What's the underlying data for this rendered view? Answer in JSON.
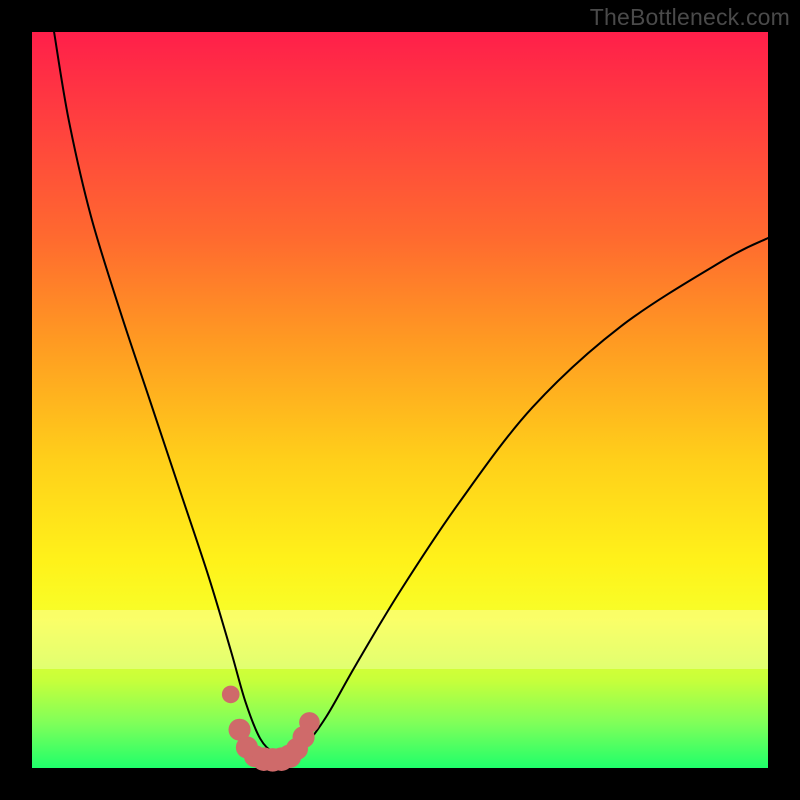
{
  "watermark": "TheBottleneck.com",
  "chart_data": {
    "type": "line",
    "title": "",
    "xlabel": "",
    "ylabel": "",
    "xlim": [
      0,
      100
    ],
    "ylim": [
      0,
      100
    ],
    "series": [
      {
        "name": "bottleneck-curve",
        "x": [
          3,
          5,
          8,
          12,
          16,
          20,
          24,
          27,
          29,
          31,
          33,
          35,
          37,
          40,
          44,
          50,
          58,
          68,
          80,
          94,
          100
        ],
        "values": [
          100,
          88,
          75,
          62,
          50,
          38,
          26,
          16,
          9,
          4,
          2,
          2,
          3,
          7,
          14,
          24,
          36,
          49,
          60,
          69,
          72
        ]
      }
    ],
    "markers": {
      "name": "highlight-dots",
      "color": "#cf6a6a",
      "points": [
        {
          "x": 27.0,
          "y": 10.0,
          "r": 1.2
        },
        {
          "x": 28.2,
          "y": 5.2,
          "r": 1.5
        },
        {
          "x": 29.2,
          "y": 2.8,
          "r": 1.5
        },
        {
          "x": 30.3,
          "y": 1.6,
          "r": 1.5
        },
        {
          "x": 31.5,
          "y": 1.2,
          "r": 1.6
        },
        {
          "x": 32.7,
          "y": 1.1,
          "r": 1.6
        },
        {
          "x": 33.9,
          "y": 1.2,
          "r": 1.6
        },
        {
          "x": 35.0,
          "y": 1.6,
          "r": 1.6
        },
        {
          "x": 36.0,
          "y": 2.6,
          "r": 1.5
        },
        {
          "x": 36.9,
          "y": 4.2,
          "r": 1.5
        },
        {
          "x": 37.7,
          "y": 6.2,
          "r": 1.4
        }
      ]
    },
    "background_gradient": {
      "top": "#ff1f4a",
      "mid": "#fff21a",
      "bottom": "#1fff6a"
    }
  }
}
